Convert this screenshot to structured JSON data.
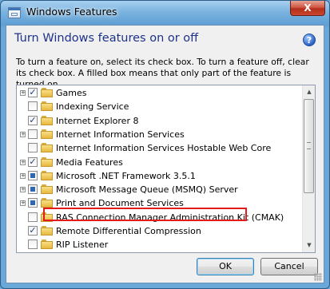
{
  "window": {
    "title": "Windows Features",
    "close_label": "X"
  },
  "dialog": {
    "heading": "Turn Windows features on or off",
    "help_label": "?",
    "instructions": "To turn a feature on, select its check box. To turn a feature off, clear its check box. A filled box means that only part of the feature is turned on."
  },
  "features": [
    {
      "label": "Games",
      "expandable": true,
      "state": "checked"
    },
    {
      "label": "Indexing Service",
      "expandable": false,
      "state": "unchecked"
    },
    {
      "label": "Internet Explorer 8",
      "expandable": false,
      "state": "checked"
    },
    {
      "label": "Internet Information Services",
      "expandable": true,
      "state": "unchecked"
    },
    {
      "label": "Internet Information Services Hostable Web Core",
      "expandable": false,
      "state": "unchecked"
    },
    {
      "label": "Media Features",
      "expandable": true,
      "state": "checked"
    },
    {
      "label": "Microsoft .NET Framework 3.5.1",
      "expandable": true,
      "state": "partial"
    },
    {
      "label": "Microsoft Message Queue (MSMQ) Server",
      "expandable": true,
      "state": "partial",
      "highlighted": true
    },
    {
      "label": "Print and Document Services",
      "expandable": true,
      "state": "partial"
    },
    {
      "label": "RAS Connection Manager Administration Kit (CMAK)",
      "expandable": false,
      "state": "unchecked"
    },
    {
      "label": "Remote Differential Compression",
      "expandable": false,
      "state": "checked"
    },
    {
      "label": "RIP Listener",
      "expandable": false,
      "state": "unchecked"
    }
  ],
  "buttons": {
    "ok": "OK",
    "cancel": "Cancel"
  },
  "colors": {
    "heading": "#1e3287",
    "highlight_border": "#e31b1b",
    "title_bar": "#6aa8da"
  }
}
